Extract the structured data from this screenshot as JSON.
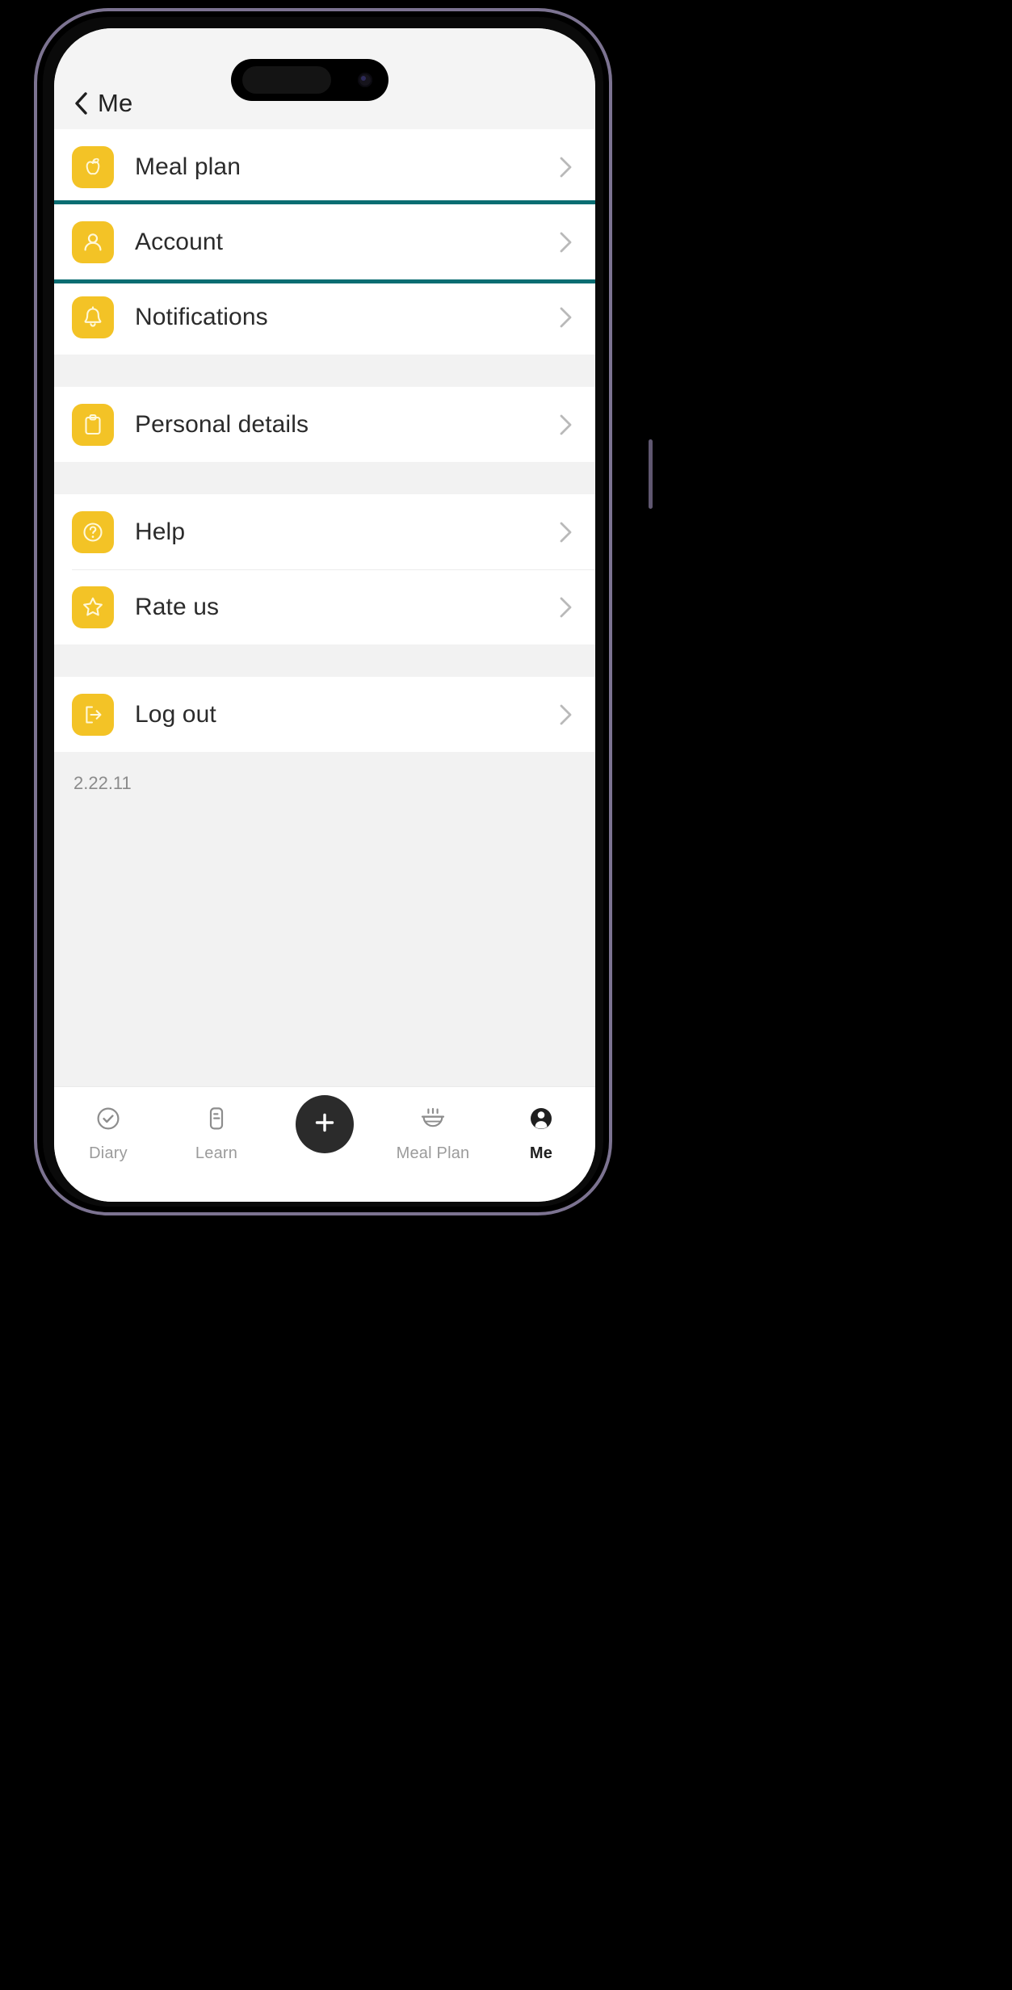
{
  "header": {
    "title": "Me",
    "back_icon": "chevron-left-icon"
  },
  "settings": {
    "groups": [
      {
        "rows": [
          {
            "label": "Meal plan",
            "icon": "apple-icon",
            "highlighted": false
          },
          {
            "label": "Account",
            "icon": "person-icon",
            "highlighted": true
          },
          {
            "label": "Notifications",
            "icon": "bell-icon",
            "highlighted": false
          }
        ]
      },
      {
        "rows": [
          {
            "label": "Personal details",
            "icon": "clipboard-icon",
            "highlighted": false
          }
        ]
      },
      {
        "rows": [
          {
            "label": "Help",
            "icon": "question-circle-icon",
            "highlighted": false
          },
          {
            "label": "Rate us",
            "icon": "star-icon",
            "highlighted": false
          }
        ]
      },
      {
        "rows": [
          {
            "label": "Log out",
            "icon": "logout-icon",
            "highlighted": false
          }
        ]
      }
    ],
    "version": "2.22.11",
    "chevron_icon": "chevron-right-icon"
  },
  "tabs": [
    {
      "label": "Diary",
      "icon": "check-circle-icon",
      "active": false
    },
    {
      "label": "Learn",
      "icon": "document-icon",
      "active": false
    },
    {
      "label": "",
      "icon": "plus-icon",
      "active": false
    },
    {
      "label": "Meal Plan",
      "icon": "bowl-icon",
      "active": false
    },
    {
      "label": "Me",
      "icon": "avatar-icon",
      "active": true
    }
  ],
  "colors": {
    "icon_tile": "#f3c326",
    "highlight_border": "#0a6d72",
    "fab": "#2b2b2b",
    "screen_bg": "#f2f2f2",
    "row_bg": "#ffffff",
    "label_text": "#2b2b2b",
    "muted_text": "#9b9b9b"
  }
}
